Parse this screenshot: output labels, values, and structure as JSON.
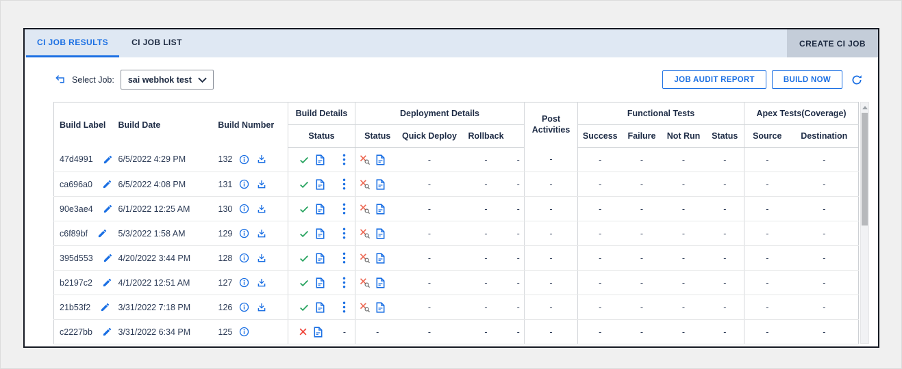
{
  "tabs": [
    {
      "label": "CI JOB RESULTS",
      "active": true
    },
    {
      "label": "CI JOB LIST",
      "active": false
    }
  ],
  "header": {
    "create_button": "CREATE CI JOB"
  },
  "toolbar": {
    "select_job_label": "Select Job:",
    "selected_job": "sai webhok test",
    "job_audit_report": "JOB AUDIT REPORT",
    "build_now": "BUILD NOW"
  },
  "colors": {
    "accent_blue": "#1a6fe3",
    "navy_text": "#1c2940",
    "success_green": "#27a35f",
    "fail_red": "#f0453a",
    "validate_fail_red": "#ed6a55",
    "tabbar_bg": "#dfe8f3",
    "create_btn_bg": "#c4cdd9"
  },
  "table": {
    "columns": {
      "build_label": "Build Label",
      "build_date": "Build Date",
      "build_number": "Build Number",
      "build_details": "Build Details",
      "build_status": "Status",
      "deployment_details": "Deployment Details",
      "deploy_status": "Status",
      "quick_deploy": "Quick Deploy",
      "rollback": "Rollback",
      "post_activities": "Post Activities",
      "functional_tests": "Functional Tests",
      "success": "Success",
      "failure": "Failure",
      "not_run": "Not Run",
      "tests_status": "Status",
      "apex_tests": "Apex Tests(Coverage)",
      "source": "Source",
      "destination": "Destination"
    },
    "rows": [
      {
        "label": "47d4991",
        "date": "6/5/2022 4:29 PM",
        "number": "132",
        "has_download": true,
        "build_status": "success",
        "menu": "kebab",
        "deploy_status": "validate-failed",
        "quick_deploy": "-",
        "rollback": "-",
        "deploy_action": "-",
        "post_activities": "-",
        "success": "-",
        "failure": "-",
        "not_run": "-",
        "test_status": "-",
        "source": "-",
        "destination": "-"
      },
      {
        "label": "ca696a0",
        "date": "6/5/2022 4:08 PM",
        "number": "131",
        "has_download": true,
        "build_status": "success",
        "menu": "kebab",
        "deploy_status": "validate-failed",
        "quick_deploy": "-",
        "rollback": "-",
        "deploy_action": "-",
        "post_activities": "-",
        "success": "-",
        "failure": "-",
        "not_run": "-",
        "test_status": "-",
        "source": "-",
        "destination": "-"
      },
      {
        "label": "90e3ae4",
        "date": "6/1/2022 12:25 AM",
        "number": "130",
        "has_download": true,
        "build_status": "success",
        "menu": "kebab",
        "deploy_status": "validate-failed",
        "quick_deploy": "-",
        "rollback": "-",
        "deploy_action": "-",
        "post_activities": "-",
        "success": "-",
        "failure": "-",
        "not_run": "-",
        "test_status": "-",
        "source": "-",
        "destination": "-"
      },
      {
        "label": "c6f89bf",
        "date": "5/3/2022 1:58 AM",
        "number": "129",
        "has_download": true,
        "build_status": "success",
        "menu": "kebab",
        "deploy_status": "validate-failed",
        "quick_deploy": "-",
        "rollback": "-",
        "deploy_action": "-",
        "post_activities": "-",
        "success": "-",
        "failure": "-",
        "not_run": "-",
        "test_status": "-",
        "source": "-",
        "destination": "-"
      },
      {
        "label": "395d553",
        "date": "4/20/2022 3:44 PM",
        "number": "128",
        "has_download": true,
        "build_status": "success",
        "menu": "kebab",
        "deploy_status": "validate-failed",
        "quick_deploy": "-",
        "rollback": "-",
        "deploy_action": "-",
        "post_activities": "-",
        "success": "-",
        "failure": "-",
        "not_run": "-",
        "test_status": "-",
        "source": "-",
        "destination": "-"
      },
      {
        "label": "b2197c2",
        "date": "4/1/2022 12:51 AM",
        "number": "127",
        "has_download": true,
        "build_status": "success",
        "menu": "kebab",
        "deploy_status": "validate-failed",
        "quick_deploy": "-",
        "rollback": "-",
        "deploy_action": "-",
        "post_activities": "-",
        "success": "-",
        "failure": "-",
        "not_run": "-",
        "test_status": "-",
        "source": "-",
        "destination": "-"
      },
      {
        "label": "21b53f2",
        "date": "3/31/2022 7:18 PM",
        "number": "126",
        "has_download": true,
        "build_status": "success",
        "menu": "kebab",
        "deploy_status": "validate-failed",
        "quick_deploy": "-",
        "rollback": "-",
        "deploy_action": "-",
        "post_activities": "-",
        "success": "-",
        "failure": "-",
        "not_run": "-",
        "test_status": "-",
        "source": "-",
        "destination": "-"
      },
      {
        "label": "c2227bb",
        "date": "3/31/2022 6:34 PM",
        "number": "125",
        "has_download": false,
        "build_status": "failed",
        "menu": "-",
        "deploy_status": "-",
        "quick_deploy": "-",
        "rollback": "-",
        "deploy_action": "-",
        "post_activities": "-",
        "success": "-",
        "failure": "-",
        "not_run": "-",
        "test_status": "-",
        "source": "-",
        "destination": "-"
      }
    ]
  }
}
